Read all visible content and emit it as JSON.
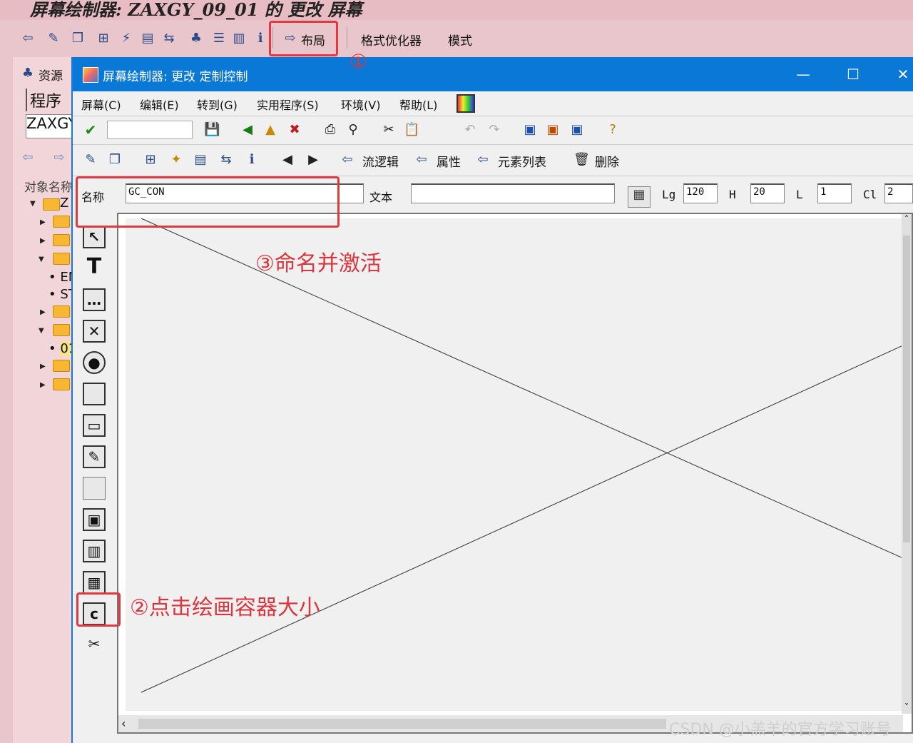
{
  "outer": {
    "title": "屏幕绘制器: ZAXGY_09_01 的 更改 屏幕",
    "layout_button": "布局",
    "format_optimizer": "格式优化器",
    "mode": "模式",
    "resource_label": "资源",
    "program_label": "程序",
    "program_value": "ZAXGY",
    "object_name_label": "对象名称",
    "tree": [
      {
        "text": "Z"
      },
      {
        "text": "EN"
      },
      {
        "text": "ST"
      },
      {
        "text": "01"
      }
    ]
  },
  "dialog": {
    "title": "屏幕绘制器:  更改 定制控制",
    "menus": [
      "屏幕(C)",
      "编辑(E)",
      "转到(G)",
      "实用程序(S)",
      "环境(V)",
      "帮助(L)"
    ],
    "app_buttons": {
      "flow_logic": "流逻辑",
      "attributes": "属性",
      "element_list": "元素列表",
      "delete": "删除"
    },
    "attr": {
      "name_label": "名称",
      "name_value": "GC_CON",
      "text_label": "文本",
      "text_value": "",
      "lg_label": "Lg",
      "lg_value": "120",
      "h_label": "H",
      "h_value": "20",
      "l_label": "L",
      "l_value": "1",
      "cl_label": "Cl",
      "cl_value": "2"
    }
  },
  "annotations": {
    "a1": "①",
    "a2": "②点击绘画容器大小",
    "a3": "③命名并激活"
  },
  "watermark": "CSDN @小羔羊的官方学习账号",
  "colors": {
    "title_blue": "#0a78d7",
    "annotation_red": "#e0393f",
    "outer_pink": "#e9c6cb"
  }
}
